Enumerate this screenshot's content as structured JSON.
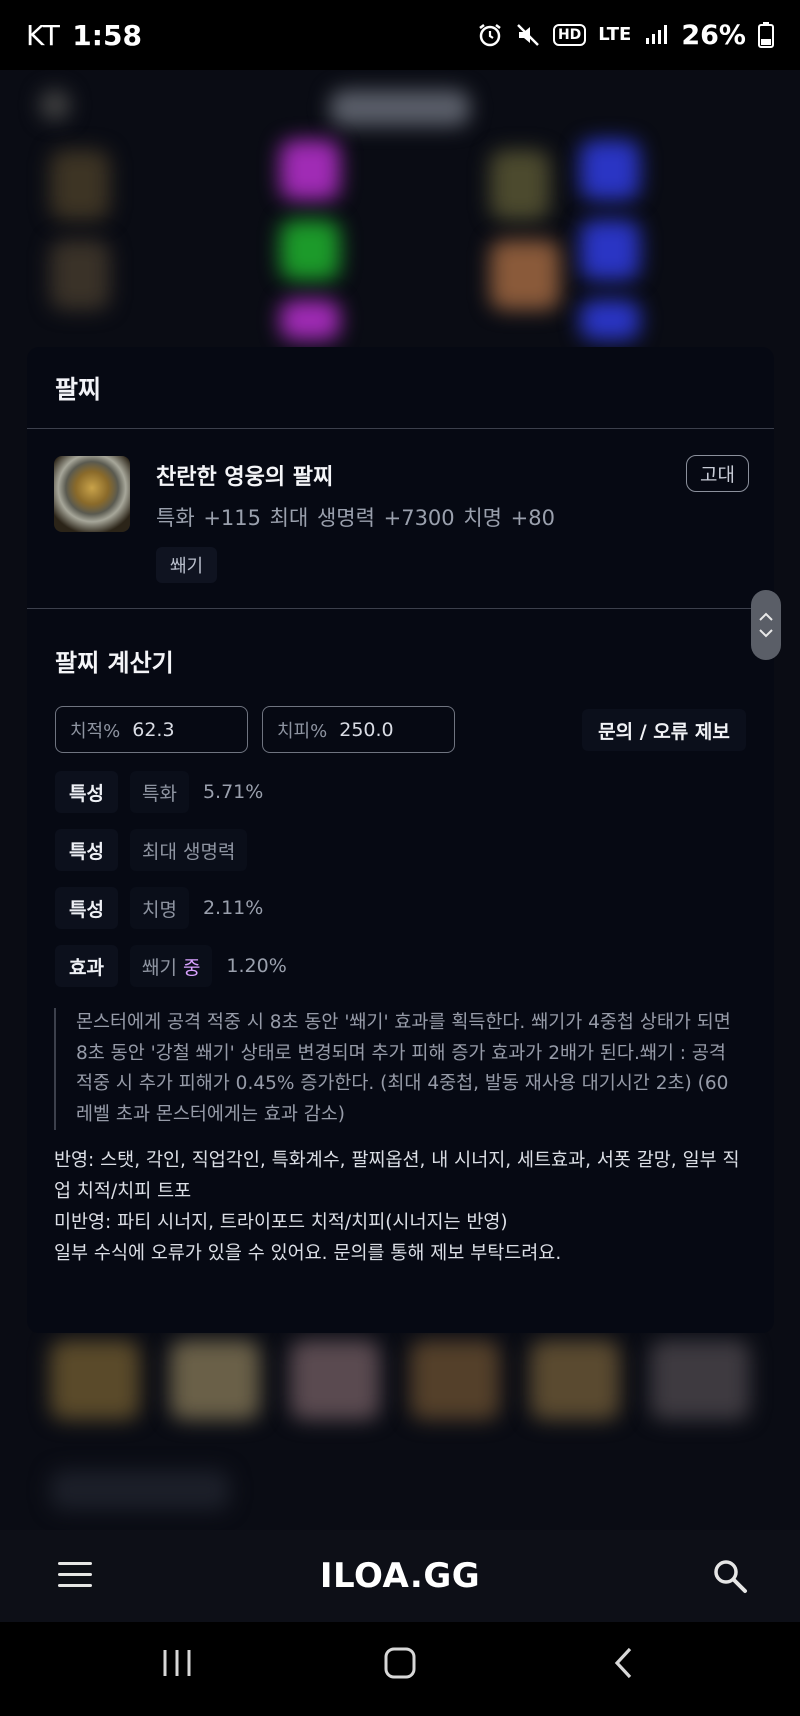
{
  "status_bar": {
    "carrier": "KT",
    "time": "1:58",
    "network": "LTE",
    "hd": "HD",
    "battery": "26%",
    "icons": [
      "alarm-icon",
      "mute-icon",
      "hd-icon",
      "lte-icon",
      "signal-icon",
      "battery-icon"
    ]
  },
  "modal": {
    "title": "팔찌",
    "item": {
      "name": "찬란한 영웅의 팔찌",
      "stats": "특화 +115  최대 생명력 +7300  치명 +80",
      "tag": "쐐기",
      "grade": "고대",
      "icon": "bracelet-icon"
    },
    "calculator": {
      "title": "팔찌 계산기",
      "crit_rate": {
        "label": "치적%",
        "value": "62.3"
      },
      "crit_dmg": {
        "label": "치피%",
        "value": "250.0"
      },
      "report_button": "문의 / 오류 제보",
      "rows": [
        {
          "kind": "특성",
          "name": "특화",
          "pct": "5.71%"
        },
        {
          "kind": "특성",
          "name": "최대 생명력",
          "pct": ""
        },
        {
          "kind": "특성",
          "name": "치명",
          "pct": "2.11%"
        },
        {
          "kind": "효과",
          "name": "쐐기",
          "grade": "중",
          "pct": "1.20%"
        }
      ],
      "effect_description": "몬스터에게 공격 적중 시 8초 동안 '쐐기' 효과를 획득한다. 쐐기가 4중첩 상태가 되면 8초 동안 '강철 쐐기' 상태로 변경되며 추가 피해 증가 효과가 2배가 된다.쐐기 : 공격 적중 시 추가 피해가 0.45% 증가한다. (최대 4중첩, 발동 재사용 대기시간 2초) (60레벨 초과 몬스터에게는 효과 감소)",
      "notes": [
        "반영: 스탯, 각인, 직업각인, 특화계수, 팔찌옵션, 내 시너지, 세트효과, 서폿 갈망, 일부 직업 치적/치피 트포",
        "미반영: 파티 시너지, 트라이포드 치적/치피(시너지는 반영)",
        "일부 수식에 오류가 있을 수 있어요. 문의를 통해 제보 부탁드려요."
      ]
    }
  },
  "app_bar": {
    "logo": "ILOA.GG",
    "menu_icon": "hamburger-menu-icon",
    "search_icon": "search-icon"
  },
  "nav_bar": {
    "buttons": [
      "recent-apps-icon",
      "home-icon",
      "back-icon"
    ]
  }
}
